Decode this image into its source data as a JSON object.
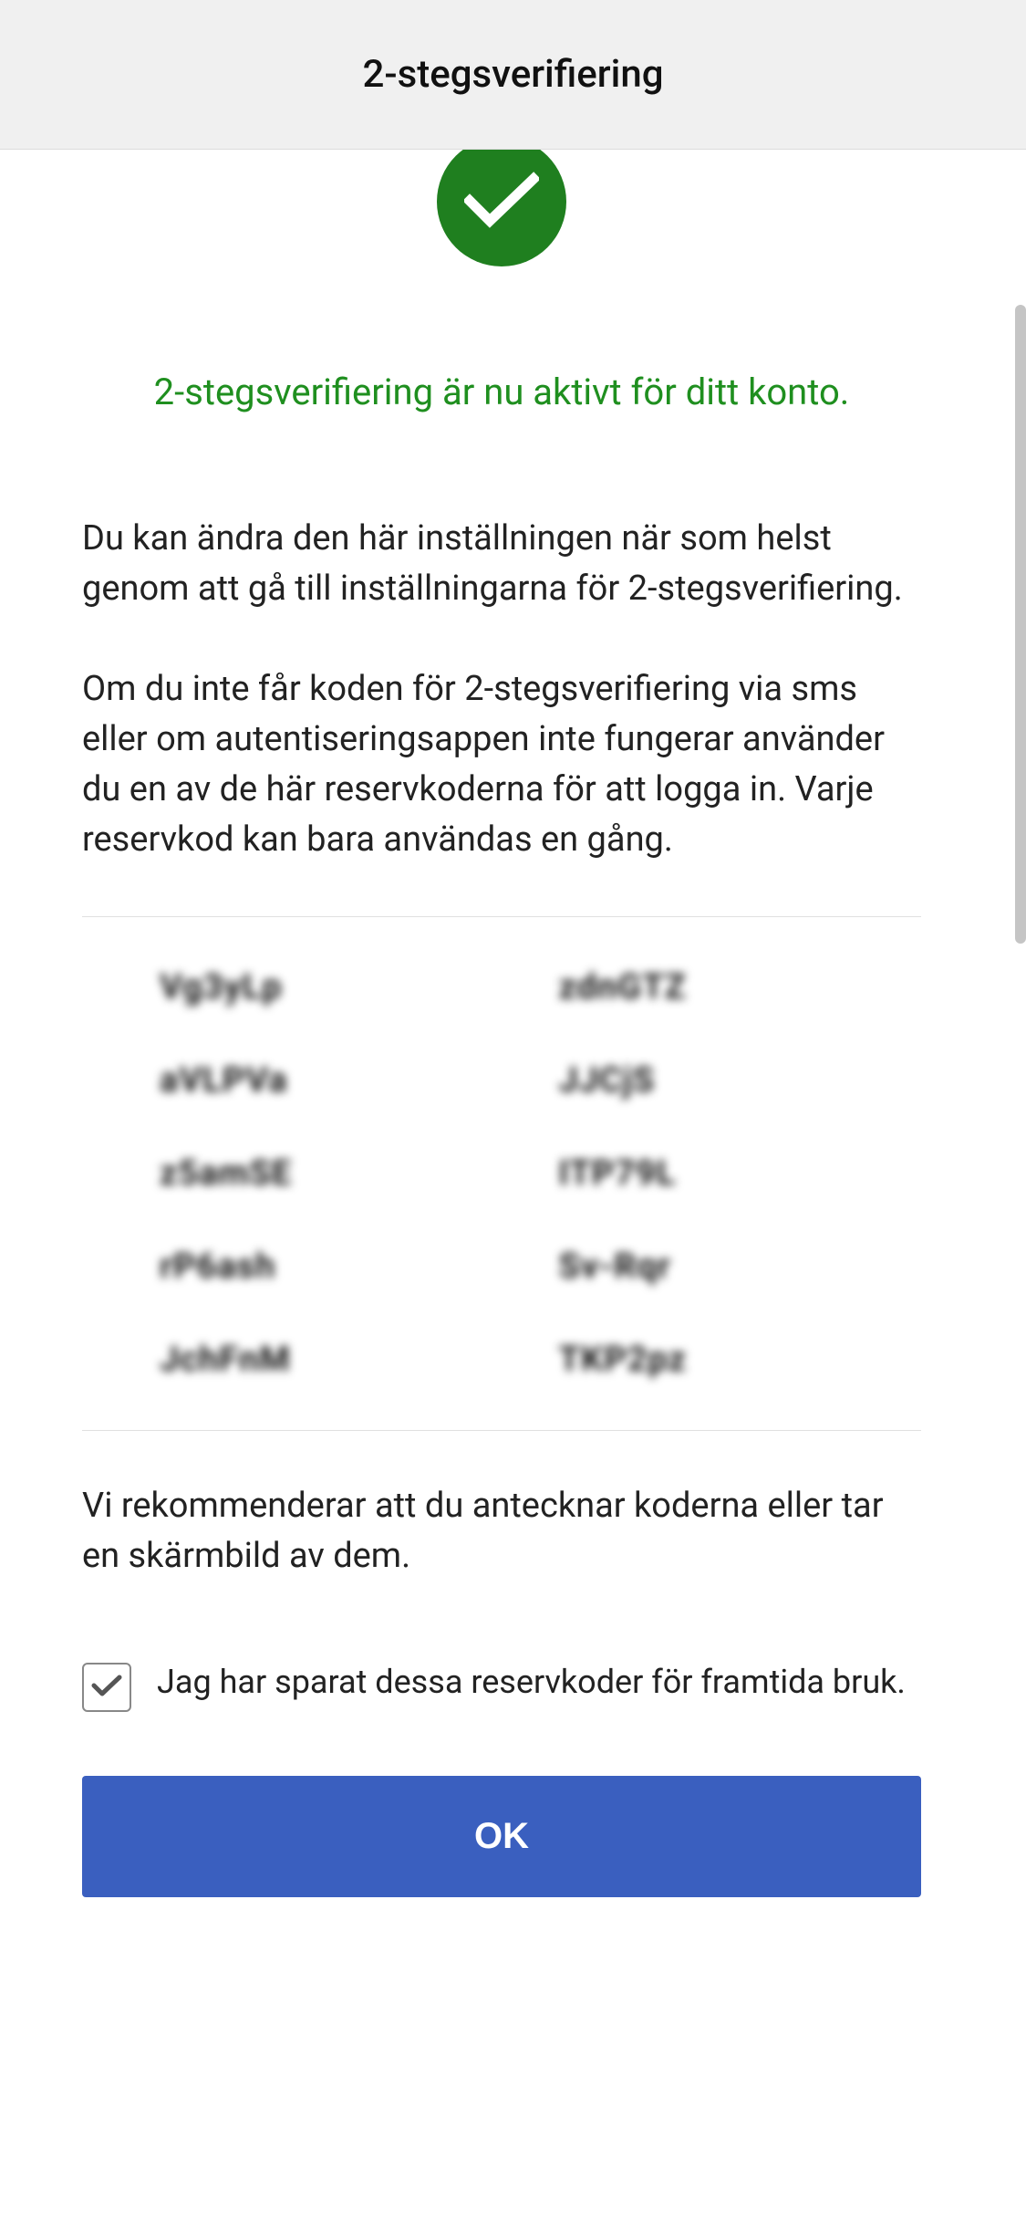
{
  "header": {
    "title": "2-stegsverifiering"
  },
  "main": {
    "success_headline": "2-stegsverifiering är nu aktivt för ditt konto.",
    "paragraph1": "Du kan ändra den här inställningen när som helst genom att gå till inställningarna för 2-stegsverifiering.",
    "paragraph2": "Om du inte får koden för 2-stegsverifiering via sms eller om autentiseringsappen inte fungerar använder du en av de här reservkoderna för att logga in. Varje reservkod kan bara användas en gång.",
    "codes_left": [
      "Vg3yLp",
      "aVLPVa",
      "z5amSE",
      "rP6ash",
      "JchFnM"
    ],
    "codes_right": [
      "zdnGTZ",
      "JJCjS",
      "ITP79L",
      "Sv-Rqr",
      "TKP2pz"
    ],
    "recommend_text": "Vi rekommenderar att du antecknar koderna eller tar en skärmbild av dem.",
    "saved_checkbox_label": "Jag har sparat dessa reservkoder för framtida bruk.",
    "ok_button_label": "OK"
  },
  "icons": {
    "check": "check-icon",
    "small_check": "checkbox-check-icon"
  },
  "colors": {
    "success_green": "#1f8f1f",
    "primary_blue": "#3a5fbf"
  }
}
